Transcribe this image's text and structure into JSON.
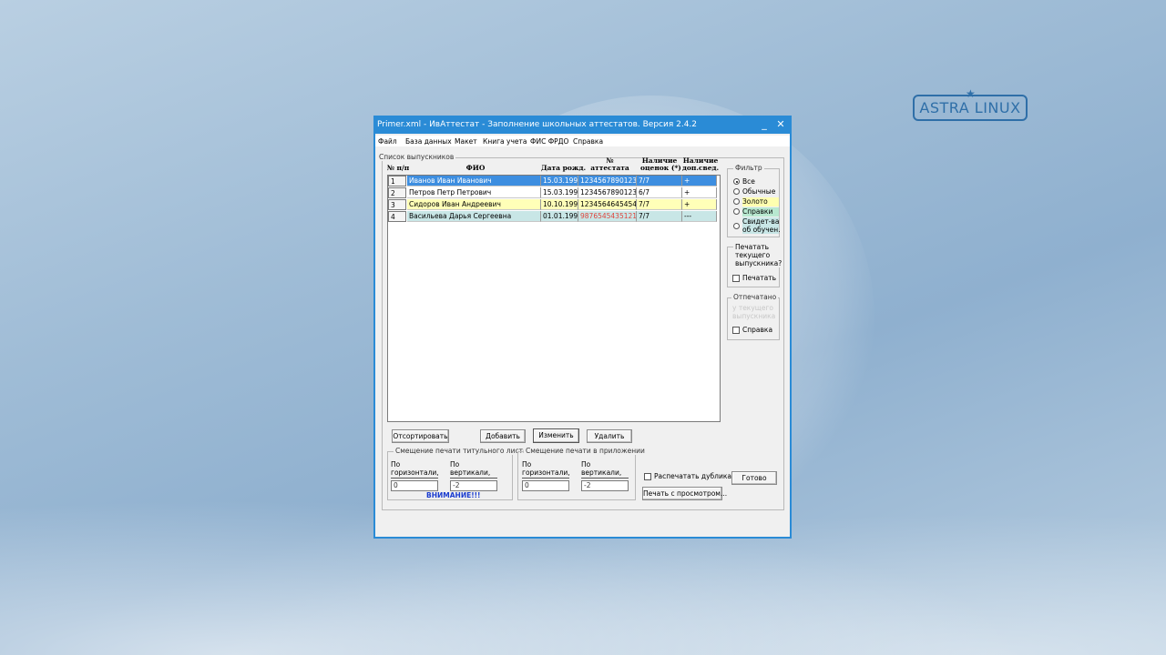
{
  "desktop": {
    "logo": "ASTRA LINUX"
  },
  "window": {
    "title": "Primer.xml - ИвАттестат - Заполнение школьных аттестатов. Версия 2.4.2",
    "minimize": "_",
    "close": "✕"
  },
  "menu": [
    "Файл",
    "База данных",
    "Макет",
    "Книга учета",
    "ФИС ФРДО",
    "Справка"
  ],
  "graduates": {
    "group_title": "Список выпускников",
    "headers": {
      "num": "№ п/п",
      "fio": "ФИО",
      "birth": "Дата рожд.",
      "cert_l1": "№",
      "cert_l2": "аттестата",
      "grades_l1": "Наличие",
      "grades_l2": "оценок (*)",
      "extra_l1": "Наличие",
      "extra_l2": "доп.свед."
    },
    "rows": [
      {
        "num": "1",
        "fio": "Иванов Иван Иванович",
        "birth": "15.03.1994",
        "cert": "12345678901234",
        "grades": "7/7",
        "extra": "+"
      },
      {
        "num": "2",
        "fio": "Петров Петр Петрович",
        "birth": "15.03.1994",
        "cert": "12345678901233",
        "grades": "6/7",
        "extra": "+"
      },
      {
        "num": "3",
        "fio": "Сидоров Иван Андреевич",
        "birth": "10.10.1999",
        "cert": "12345646454540",
        "grades": "7/7",
        "extra": "+"
      },
      {
        "num": "4",
        "fio": "Васильева Дарья Сергеевна",
        "birth": "01.01.1999",
        "cert": "98765454351219",
        "grades": "7/7",
        "extra": "---"
      }
    ],
    "row_colors": [
      "#3d8ee0",
      "#ffffff",
      "#ffffb8",
      "#c8e6e6"
    ],
    "cert_alert_color": "#e0443c"
  },
  "buttons": {
    "sort": "Отсортировать",
    "add": "Добавить",
    "edit": "Изменить",
    "delete": "Удалить",
    "print_preview": "Печать с просмотром...",
    "done": "Готово"
  },
  "offset_title": {
    "group_title": "Смещение печати титульного листа",
    "h_label_1": "По",
    "h_label_2": "горизонтали,",
    "v_label_1": "По",
    "v_label_2": "вертикали,",
    "h_value": "0",
    "v_value": "-2",
    "warning": "ВНИМАНИЕ!!!"
  },
  "offset_appendix": {
    "group_title": "Смещение печати в приложении",
    "h_label_1": "По",
    "h_label_2": "горизонтали,",
    "v_label_1": "По",
    "v_label_2": "вертикали,",
    "h_value": "0",
    "v_value": "-2"
  },
  "duplicate": {
    "label": "Распечатать дубликат",
    "checked": false
  },
  "filter": {
    "group_title": "Фильтр",
    "options": [
      "Все",
      "Обычные",
      "Золото",
      "Справки",
      "Свидет-ва",
      "об обучен."
    ],
    "selected": "Все",
    "colors": {
      "gold": "#ffffb0",
      "cert": "#b8e8d0",
      "study": "#c8e6e6"
    }
  },
  "print_current": {
    "title_1": "Печатать",
    "title_2": "текущего",
    "title_3": "выпускника?",
    "checkbox": "Печатать"
  },
  "printed": {
    "group_title": "Отпечатано",
    "faded_1": "у текущего",
    "faded_2": "выпускника",
    "checkbox": "Справка"
  }
}
